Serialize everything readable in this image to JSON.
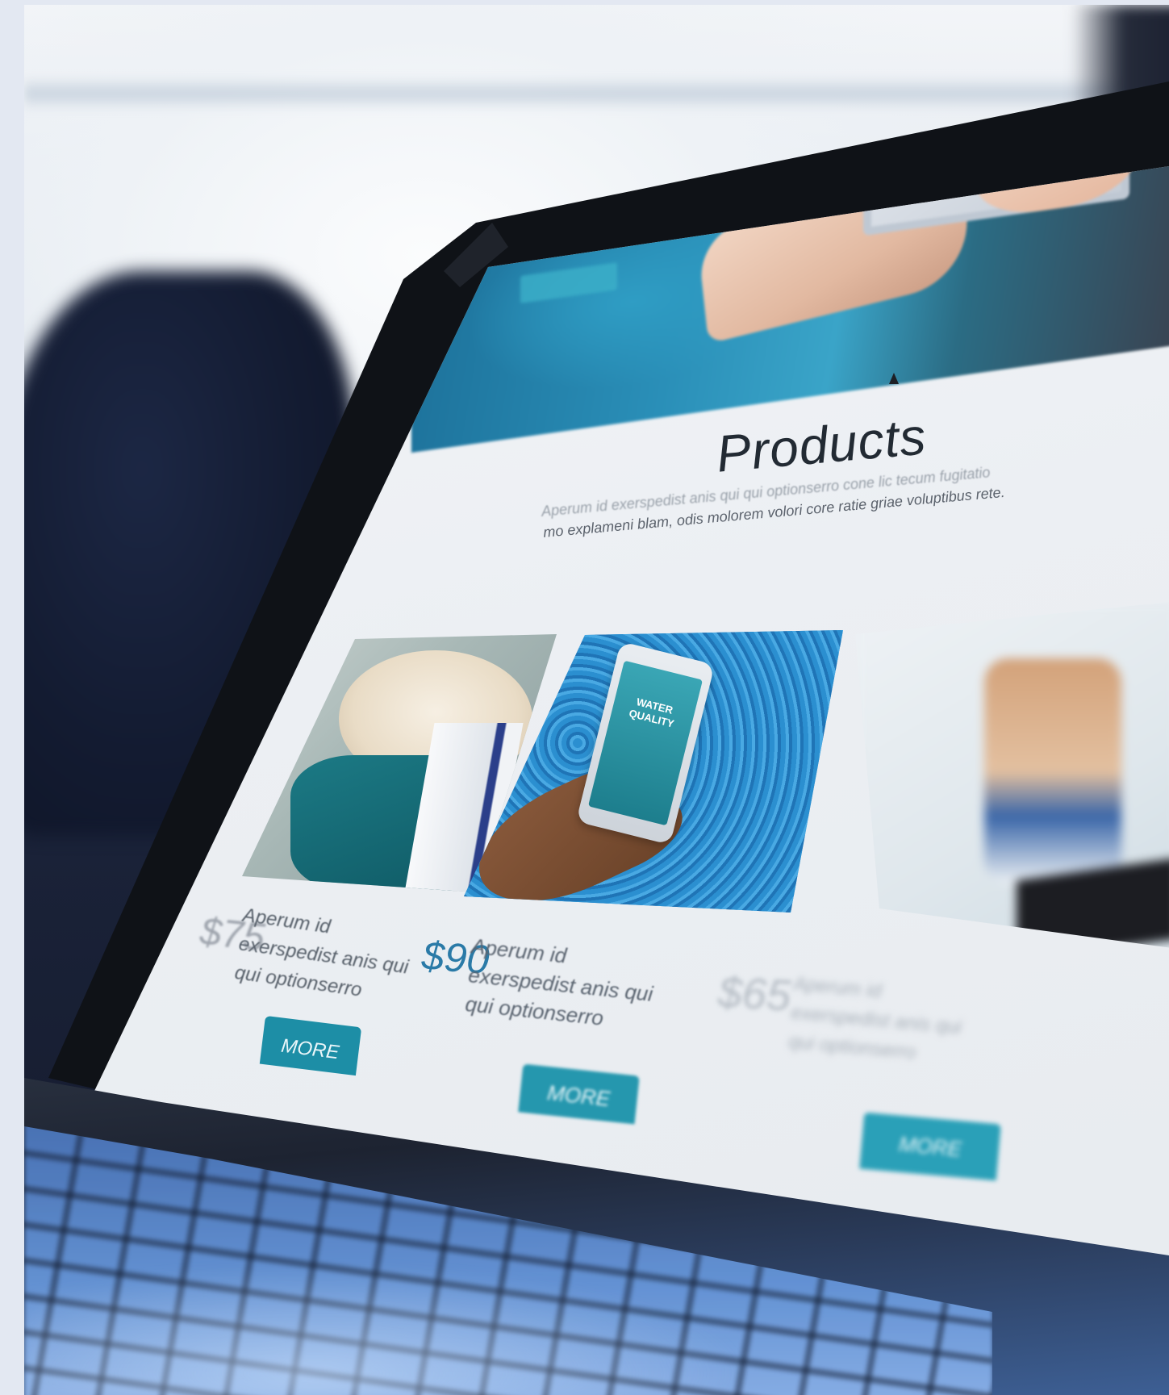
{
  "products": {
    "title": "Products",
    "description_line1": "Aperum id exerspedist anis qui qui optionserro cone lic tecum fugitatio",
    "description_line2": "mo explameni blam, odis molorem volori core ratie griae voluptibus rete."
  },
  "phone_screen": {
    "label": "WATER QUALITY"
  },
  "cards": [
    {
      "price": "$75",
      "desc_line1": "Aperum id",
      "desc_line2": "exerspedist anis qui",
      "desc_line3": "qui optionserro",
      "button": "MORE"
    },
    {
      "price": "$90",
      "desc_line1": "Aperum id",
      "desc_line2": "exerspedist anis qui",
      "desc_line3": "qui optionserro",
      "button": "MORE"
    },
    {
      "price": "$65",
      "desc_line1": "Aperum id",
      "desc_line2": "exerspedist anis qui",
      "desc_line3": "qui optionserro",
      "button": "MORE"
    }
  ],
  "colors": {
    "accent": "#1d8ea6",
    "price_highlight": "#2a7aa7",
    "page_background": "#e3e8f2"
  }
}
